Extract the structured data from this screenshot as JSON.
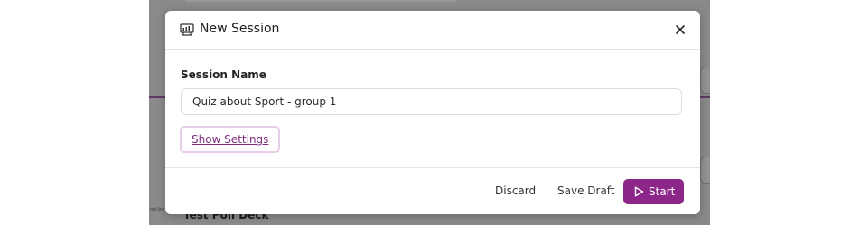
{
  "background": {
    "deck_title": "Test Poll Deck",
    "tiny_label": "nol by"
  },
  "modal": {
    "title": "New Session",
    "header_icon": "presentation-icon",
    "close_icon": "close-icon",
    "session_name_label": "Session Name",
    "session_name_value": "Quiz about Sport - group 1",
    "show_settings_label": "Show Settings",
    "footer": {
      "discard_label": "Discard",
      "save_draft_label": "Save Draft",
      "start_label": "Start",
      "start_icon": "play-icon"
    }
  },
  "colors": {
    "accent": "#8c2789",
    "link": "#7e2d7e",
    "link_focus_ring": "#e7cde7",
    "overlay": "#8a8a8a"
  }
}
